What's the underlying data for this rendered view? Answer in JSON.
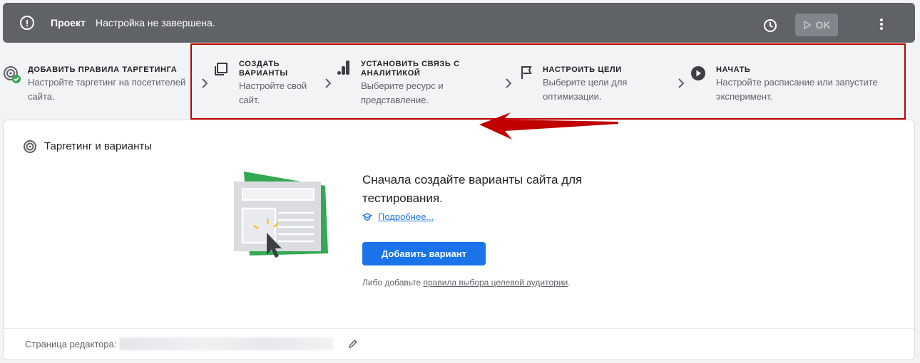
{
  "topbar": {
    "project_label": "Проект",
    "status": "Настройка не завершена.",
    "ok_label": "OK",
    "icons": {
      "warning": "warning-circle-icon",
      "history": "clock-icon",
      "play": "play-icon",
      "more": "more-vert-icon"
    }
  },
  "steps": [
    {
      "title": "ДОБАВИТЬ ПРАВИЛА ТАРГЕТИНГА",
      "desc_l1": "Настройте таргетинг на посетителей",
      "desc_l2": "сайта.",
      "icon": "target-check-icon"
    },
    {
      "title_l1": "СОЗДАТЬ",
      "title_l2": "ВАРИАНТЫ",
      "desc_l1": "Настройте свой",
      "desc_l2": "сайт.",
      "icon": "variants-icon"
    },
    {
      "title_l1": "УСТАНОВИТЬ СВЯЗЬ С",
      "title_l2": "АНАЛИТИКОЙ",
      "desc_l1": "Выберите ресурс и",
      "desc_l2": "представление.",
      "icon": "analytics-icon"
    },
    {
      "title": "НАСТРОИТЬ ЦЕЛИ",
      "desc_l1": "Выберите цели для",
      "desc_l2": "оптимизации.",
      "icon": "flag-icon"
    },
    {
      "title": "НАЧАТЬ",
      "desc_l1": "Настройте расписание или запустите",
      "desc_l2": "эксперимент.",
      "icon": "play-circle-icon"
    }
  ],
  "card": {
    "title": "Таргетинг и варианты",
    "empty_title": "Сначала создайте варианты сайта для тестирования.",
    "learn_more": "Подробнее...",
    "add_button": "Добавить вариант",
    "alt_prefix": "Либо добавьте ",
    "alt_link": "правила выбора целевой аудитории",
    "alt_suffix": ".",
    "editor_label": "Страница редактора:"
  },
  "colors": {
    "accent": "#1a73e8",
    "topbar": "#5f6368",
    "highlight": "#c00000",
    "success": "#34a853"
  }
}
